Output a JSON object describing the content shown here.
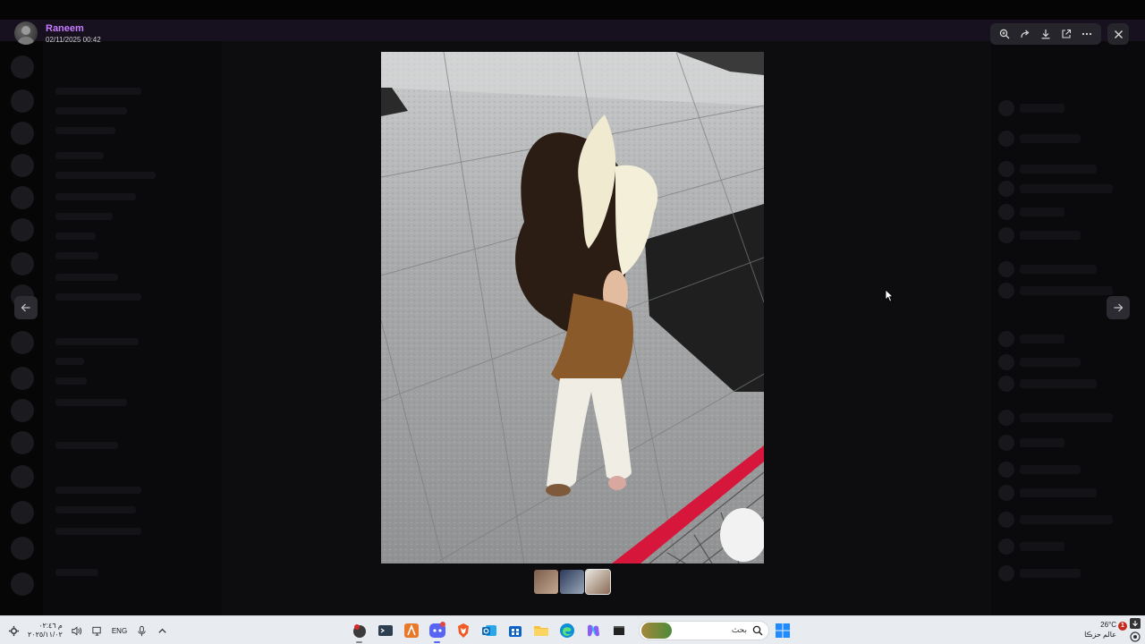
{
  "viewer": {
    "author": "Raneem",
    "timestamp": "02/11/2025 00:42",
    "toolbar": {
      "zoom_icon": "zoom-in-icon",
      "forward_icon": "forward-icon",
      "download_icon": "download-icon",
      "open_external_icon": "open-external-icon",
      "more_icon": "more-icon"
    },
    "close_icon": "close-icon",
    "prev_icon": "arrow-left-icon",
    "next_icon": "arrow-right-icon",
    "thumbnail_count": 3
  },
  "taskbar": {
    "clock_time": "م ٠٢:٤٦",
    "clock_date": "٢٠٢٥/١١/٠٢",
    "language": "ENG",
    "search_placeholder": "بحث",
    "weather_temp": "26°C",
    "weather_desc": "عالم حزڪا",
    "notification_count": "1"
  },
  "colors": {
    "author": "#c77dff",
    "toolbar_bg": "#25252b",
    "taskbar_bg": "#e8ebf0"
  }
}
